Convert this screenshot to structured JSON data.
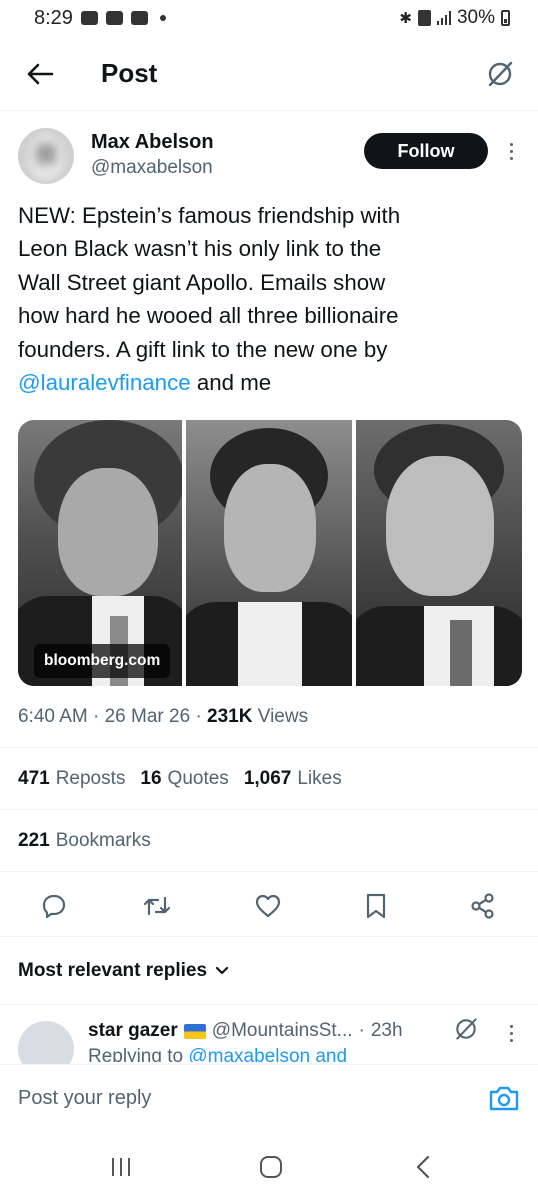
{
  "status_bar": {
    "time": "8:29",
    "battery": "30%",
    "icons": [
      "gallery-icon",
      "youtube-icon",
      "youtube-icon",
      "dot-icon",
      "bluetooth-icon",
      "vibrate-icon",
      "signal-icon",
      "battery-icon"
    ]
  },
  "header": {
    "title": "Post",
    "back_icon": "arrow-left-icon",
    "grok_icon": "grok-icon"
  },
  "post": {
    "author": {
      "name": "Max Abelson",
      "handle": "@maxabelson"
    },
    "follow_label": "Follow",
    "text_lines": [
      "NEW: Epstein’s famous friendship with",
      "Leon Black wasn’t his only link to the",
      "Wall Street giant Apollo. Emails show",
      "how hard he wooed all three billionaire",
      "founders. A gift link to the new one by"
    ],
    "text_mention": "@lauralevfinance",
    "text_suffix": " and me",
    "media_source": "bloomberg.com",
    "time": "6:40 AM",
    "date": "26 Mar 26",
    "views_count": "231K",
    "views_label": "Views",
    "reposts_count": "471",
    "reposts_label": "Reposts",
    "quotes_count": "16",
    "quotes_label": "Quotes",
    "likes_count": "1,067",
    "likes_label": "Likes",
    "bookmarks_count": "221",
    "bookmarks_label": "Bookmarks"
  },
  "actions": [
    "reply-icon",
    "repost-icon",
    "like-icon",
    "bookmark-icon",
    "share-icon"
  ],
  "replies": {
    "filter_label": "Most relevant replies",
    "first_reply": {
      "name": "star gazer",
      "handle": "@MountainsSt...",
      "time": "23h",
      "context_prefix": "Replying to ",
      "context_mention": "@maxabelson and"
    }
  },
  "compose": {
    "placeholder": "Post your reply"
  },
  "nav_bar": [
    "recents-icon",
    "home-icon",
    "back-icon"
  ],
  "colors": {
    "accent": "#1d9bf0",
    "text": "#0f1419",
    "muted": "#536471"
  }
}
